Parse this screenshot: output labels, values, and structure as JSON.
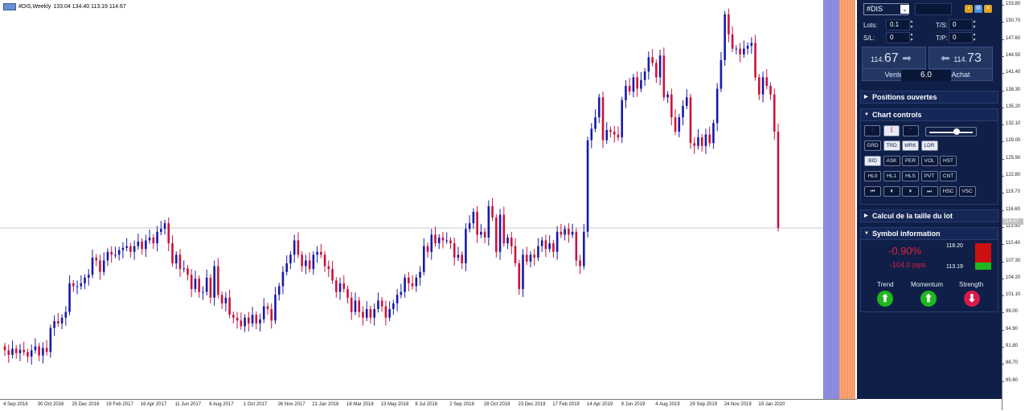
{
  "chart": {
    "title": "#DIS,Weekly",
    "ohlc": "133.04 134.40 113.19 114.67",
    "current_price_label": "114.67",
    "price_ticks": [
      "153.80",
      "150.70",
      "147.60",
      "144.50",
      "141.40",
      "138.30",
      "135.20",
      "132.10",
      "129.00",
      "125.90",
      "122.80",
      "119.70",
      "116.60",
      "113.50",
      "110.40",
      "107.30",
      "104.20",
      "101.10",
      "98.00",
      "94.90",
      "91.80",
      "88.70",
      "85.60"
    ],
    "time_ticks": [
      "4 Sep 2016",
      "30 Oct 2016",
      "25 Dec 2016",
      "19 Feb 2017",
      "16 Apr 2017",
      "11 Jun 2017",
      "6 Aug 2017",
      "1 Oct 2017",
      "26 Nov 2017",
      "21 Jan 2018",
      "18 Mar 2018",
      "13 May 2018",
      "8 Jul 2018",
      "2 Sep 2018",
      "28 Oct 2018",
      "23 Dec 2018",
      "17 Feb 2019",
      "14 Apr 2019",
      "9 Jun 2019",
      "4 Aug 2019",
      "29 Sep 2019",
      "24 Nov 2019",
      "19 Jan 2020"
    ]
  },
  "chart_data": {
    "type": "candlestick",
    "title": "#DIS,Weekly",
    "ylim": [
      84.8,
      154.5
    ],
    "colors": {
      "bull": "#1a1aa6",
      "bear": "#c8143c",
      "price_line": "#c8c8c8"
    },
    "current_price": 114.67,
    "grid": false,
    "close": [
      93.3,
      92.5,
      93.6,
      92.8,
      93.4,
      93.0,
      92.2,
      93.3,
      94.0,
      92.4,
      93.7,
      93.0,
      97.2,
      98.4,
      98.0,
      99.0,
      100.0,
      105.0,
      104.5,
      104.5,
      105.0,
      106.0,
      106.5,
      109.5,
      109.0,
      107.0,
      109.0,
      110.5,
      110.0,
      110.0,
      110.8,
      111.2,
      111.5,
      110.5,
      111.5,
      112.3,
      111.0,
      112.5,
      113.0,
      112.0,
      114.0,
      114.5,
      115.5,
      112.0,
      108.5,
      110.0,
      107.5,
      107.6,
      106.5,
      104.0,
      105.8,
      103.5,
      103.5,
      106.0,
      102.5,
      108.0,
      103.0,
      101.5,
      102.5,
      99.5,
      99.0,
      98.5,
      97.5,
      99.0,
      98.0,
      99.5,
      98.0,
      98.7,
      101.0,
      100.5,
      98.5,
      103.0,
      104.5,
      107.0,
      108.5,
      110.0,
      112.5,
      110.0,
      108.0,
      109.0,
      107.5,
      110.0,
      110.5,
      110.0,
      108.0,
      107.5,
      105.5,
      103.5,
      105.0,
      104.0,
      102.5,
      100.0,
      102.0,
      100.0,
      99.0,
      100.5,
      99.0,
      100.5,
      102.0,
      101.0,
      99.0,
      100.5,
      101.5,
      103.0,
      103.5,
      106.0,
      105.0,
      104.5,
      106.0,
      107.0,
      111.5,
      110.5,
      113.5,
      112.0,
      113.0,
      112.5,
      112.5,
      112.0,
      109.5,
      110.0,
      108.5,
      114.5,
      115.5,
      117.5,
      113.5,
      114.0,
      113.0,
      118.5,
      116.5,
      110.5,
      117.0,
      112.0,
      113.0,
      111.5,
      108.5,
      104.0,
      110.0,
      108.8,
      110.0,
      109.5,
      111.5,
      112.5,
      111.0,
      112.0,
      110.5,
      114.0,
      113.5,
      114.5,
      113.5,
      114.0,
      109.0,
      108.0,
      114.0,
      130.0,
      132.0,
      134.0,
      137.5,
      130.0,
      131.8,
      131.5,
      131.0,
      130.5,
      137.0,
      139.5,
      138.5,
      141.0,
      139.0,
      140.5,
      142.0,
      144.5,
      143.5,
      141.0,
      144.8,
      137.5,
      138.0,
      134.0,
      131.5,
      134.0,
      136.0,
      137.5,
      129.5,
      129.0,
      130.5,
      129.0,
      131.0,
      129.5,
      133.0,
      139.0,
      144.0,
      152.0,
      148.5,
      146.0,
      146.0,
      145.0,
      146.0,
      146.5,
      147.0,
      141.0,
      138.0,
      141.0,
      139.5,
      138.0,
      131.5,
      114.67
    ],
    "open_note": "each week opens at the previous close; first open 94.0"
  },
  "panel": {
    "symbol": "#DIS",
    "lots_label": "Lots:",
    "lots_value": "0.1",
    "sl_label": "S/L:",
    "sl_value": "0",
    "ts_label": "T/S:",
    "ts_value": "0",
    "tp_label": "T/P:",
    "tp_value": "0",
    "sell": {
      "prefix": "114.",
      "suffix": "67",
      "label": "Vente"
    },
    "buy": {
      "prefix": "114.",
      "suffix": "73",
      "label": "Achat"
    },
    "spread": "6.0",
    "sections": {
      "positions": "Positions ouvertes",
      "chart_controls": "Chart controls",
      "lot_size": "Calcul de la taille du lot",
      "symbol_info": "Symbol information"
    },
    "control_rows": [
      [
        "GRD",
        "TRD",
        "MRK",
        "LDR"
      ],
      [
        "BID",
        "ASK",
        "PER",
        "VOL",
        "HST"
      ],
      [
        "HL0",
        "HL1",
        "HLS",
        "PVT",
        "CNT"
      ],
      [
        "⏮",
        "⏴",
        "⏵",
        "⏭",
        "HSC",
        "VSC"
      ]
    ],
    "symbol_info": {
      "change_pct": "-0.90%",
      "change_pips": "-104.0 pips",
      "high": "118.20",
      "low": "113.19",
      "trend_label": "Trend",
      "momentum_label": "Momentum",
      "strength_label": "Strength"
    }
  }
}
